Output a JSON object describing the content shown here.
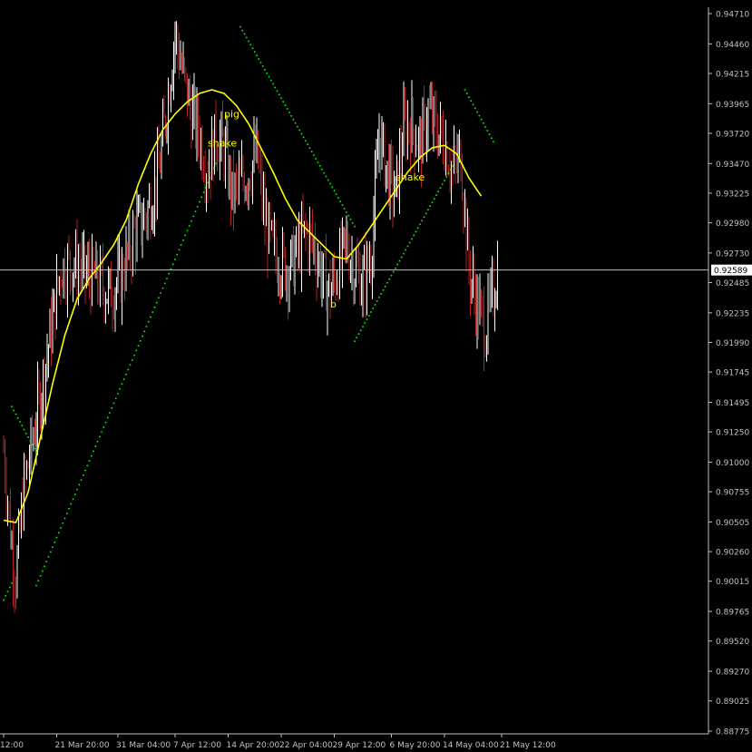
{
  "chart_data": {
    "type": "candlestick",
    "price_axis": {
      "ticks": [
        "0.94710",
        "0.94460",
        "0.94215",
        "0.93965",
        "0.93720",
        "0.93470",
        "0.93225",
        "0.92980",
        "0.92730",
        "0.92485",
        "0.92235",
        "0.91990",
        "0.91745",
        "0.91495",
        "0.91250",
        "0.91000",
        "0.90755",
        "0.90505",
        "0.90260",
        "0.90015",
        "0.89765",
        "0.89520",
        "0.89270",
        "0.89025",
        "0.88775"
      ],
      "range": [
        0.88775,
        0.9471
      ]
    },
    "time_axis": {
      "ticks": [
        "12:00",
        "21 Mar 20:00",
        "31 Mar 04:00",
        "7 Apr 12:00",
        "14 Apr 20:00",
        "22 Apr 04:00",
        "29 Apr 12:00",
        "6 May 20:00",
        "14 May 04:00",
        "21 May 12:00"
      ],
      "tick_bars": [
        0,
        13,
        28,
        42,
        55,
        68,
        81,
        95,
        108,
        122
      ]
    },
    "current_price": {
      "label": "0.92589",
      "value": 0.92589
    },
    "annotations": [
      {
        "text": "pig",
        "bar": 54,
        "price": 0.9385,
        "color": "#ffff00"
      },
      {
        "text": "shake",
        "bar": 50,
        "price": 0.9361,
        "color": "#ffff00"
      },
      {
        "text": "shake",
        "bar": 96,
        "price": 0.9333,
        "color": "#ffff00"
      },
      {
        "text": "b",
        "bar": 80,
        "price": 0.9228,
        "color": "#ffff00"
      }
    ],
    "colors": {
      "background": "#000000",
      "up_bar": "#ffffff",
      "down_bar": "#b22222",
      "moving_average": "#ffff00",
      "stop_dots": "#00ff00",
      "axis": "#c0c0c0",
      "grid_line": "#c0c0c0"
    },
    "series": [
      {
        "kind": "close_anchors",
        "bars": [
          0,
          2,
          3,
          5,
          7,
          10,
          14,
          17,
          20,
          23,
          26,
          29,
          32,
          35,
          38,
          40,
          42,
          44,
          46,
          48,
          50,
          52,
          54,
          56,
          58,
          60,
          62,
          64,
          66,
          68,
          70,
          72,
          74,
          76,
          78,
          80,
          82,
          84,
          86,
          88,
          90,
          92,
          94,
          96,
          98,
          100,
          102,
          104,
          106,
          108,
          110,
          112,
          114,
          116,
          118,
          120,
          121
        ],
        "values": [
          0.911,
          0.903,
          0.9005,
          0.908,
          0.9115,
          0.9175,
          0.926,
          0.9265,
          0.9255,
          0.925,
          0.924,
          0.9255,
          0.929,
          0.9305,
          0.934,
          0.9395,
          0.9455,
          0.942,
          0.939,
          0.937,
          0.934,
          0.937,
          0.936,
          0.932,
          0.933,
          0.934,
          0.9355,
          0.93,
          0.9275,
          0.9265,
          0.926,
          0.9275,
          0.929,
          0.928,
          0.9255,
          0.924,
          0.926,
          0.928,
          0.926,
          0.925,
          0.927,
          0.937,
          0.934,
          0.932,
          0.9375,
          0.938,
          0.936,
          0.939,
          0.9375,
          0.9365,
          0.934,
          0.9355,
          0.926,
          0.923,
          0.921,
          0.924,
          0.9259
        ]
      },
      {
        "name": "moving average",
        "bars": [
          0,
          3,
          6,
          9,
          12,
          15,
          18,
          21,
          24,
          27,
          30,
          33,
          36,
          39,
          42,
          45,
          48,
          51,
          54,
          57,
          60,
          63,
          66,
          69,
          72,
          75,
          78,
          81,
          84,
          87,
          90,
          93,
          96,
          99,
          102,
          105,
          108,
          111,
          114,
          117
        ],
        "values": [
          0.9052,
          0.905,
          0.9075,
          0.912,
          0.9165,
          0.9205,
          0.9235,
          0.9252,
          0.9265,
          0.928,
          0.93,
          0.933,
          0.9355,
          0.9375,
          0.9388,
          0.9398,
          0.9405,
          0.9408,
          0.9405,
          0.9395,
          0.938,
          0.936,
          0.934,
          0.9318,
          0.93,
          0.929,
          0.928,
          0.927,
          0.9268,
          0.928,
          0.9295,
          0.931,
          0.9325,
          0.934,
          0.9352,
          0.936,
          0.9362,
          0.9355,
          0.9335,
          0.932
        ]
      },
      {
        "name": "stop dots",
        "segments": [
          {
            "bars": [
              2,
              8
            ],
            "values": [
              0.9146,
              0.9108
            ]
          },
          {
            "bars": [
              8,
              52
            ],
            "values": [
              0.8998,
              0.9347
            ]
          },
          {
            "bars": [
              0,
              2
            ],
            "values": [
              0.8986,
              0.9
            ]
          },
          {
            "bars": [
              58,
              86
            ],
            "values": [
              0.946,
              0.9295
            ]
          },
          {
            "bars": [
              86,
              110
            ],
            "values": [
              0.92,
              0.9345
            ]
          },
          {
            "bars": [
              113,
              120
            ],
            "values": [
              0.9408,
              0.9365
            ]
          }
        ]
      }
    ]
  }
}
